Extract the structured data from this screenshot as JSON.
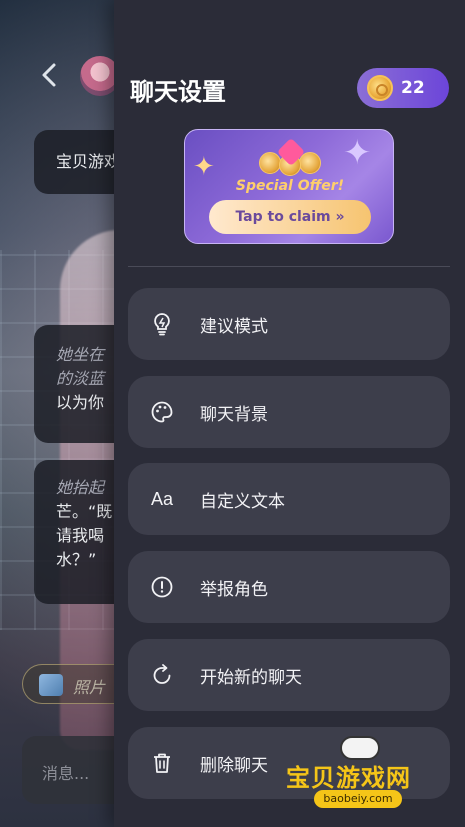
{
  "background_chat": {
    "back_label": "‹",
    "bubble1": "宝贝游戏",
    "bubble2_italic_line1": "她坐在",
    "bubble2_italic_line2": "的淡蓝",
    "bubble2_line3": "以为你",
    "bubble3_italic": "她抬起",
    "bubble3_line2": "芒。“既",
    "bubble3_line3": "请我喝",
    "bubble3_line4": "水？”",
    "photo_chip": "照片",
    "input_placeholder": "消息..."
  },
  "drawer": {
    "title": "聊天设置",
    "coins": "22",
    "offer": {
      "title": "Special Offer!",
      "button": "Tap to claim »"
    },
    "menu": [
      {
        "label": "建议模式",
        "icon": "lightbulb-icon"
      },
      {
        "label": "聊天背景",
        "icon": "palette-icon"
      },
      {
        "label": "自定义文本",
        "icon": "text-format-icon",
        "glyph": "Aa"
      },
      {
        "label": "举报角色",
        "icon": "alert-circle-icon"
      },
      {
        "label": "开始新的聊天",
        "icon": "refresh-icon"
      },
      {
        "label": "删除聊天",
        "icon": "trash-icon"
      }
    ]
  },
  "watermark": {
    "text": "宝贝游戏网",
    "url": "baobeiy.com"
  },
  "colors": {
    "drawer_bg": "#2b2c38",
    "menu_item_bg": "#3d3e4b",
    "coin_badge": "#7b58d8",
    "offer_accent": "#ffcf6b"
  }
}
